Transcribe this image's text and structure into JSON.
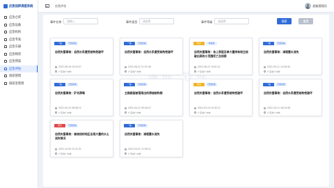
{
  "app": {
    "title": "应急指挥调度系统"
  },
  "sidebar": {
    "items": [
      {
        "label": "应急仓库",
        "active": false
      },
      {
        "label": "应急设备",
        "active": false
      },
      {
        "label": "应急机构",
        "active": false
      },
      {
        "label": "应急专家",
        "active": false
      },
      {
        "label": "应急车辆",
        "active": false
      },
      {
        "label": "应急物资",
        "active": false
      },
      {
        "label": "应急预案",
        "active": false
      },
      {
        "label": "应急评估",
        "active": true
      },
      {
        "label": "值班管理",
        "active": false
      },
      {
        "label": "值班室管理",
        "active": false
      }
    ]
  },
  "header": {
    "breadcrumb": "应急评估",
    "username": "超级管理员"
  },
  "filters": {
    "name_label": "事件名称",
    "name_placeholder": "请输入",
    "type_label": "事件类型",
    "type_placeholder": "请选择",
    "level_label": "事件等级",
    "level_placeholder": "请选择",
    "search_label": "搜索",
    "reset_label": "重置"
  },
  "colors": {
    "primary": "#2f6bd8",
    "level_blue": "#2f6bd8",
    "level_yellow": "#f0b429",
    "level_red": "#e04848"
  },
  "watermark": "博创 软件",
  "cards": [
    {
      "level": "一般",
      "level_color": "#2f6bd8",
      "status": "已经完成",
      "title": "自然灾害事故：自然水系遭受结构性破坏",
      "date": "2022-08-16 15:23:07",
      "location": "广东省广州市"
    },
    {
      "level": "一般",
      "level_color": "#2f6bd8",
      "status": "已经完成",
      "title": "自然灾害事故：自然水系遭受结构性破坏",
      "date": "2022-06-22 21:51:56",
      "location": "广东省广州市"
    },
    {
      "level": "较大",
      "level_color": "#f0b429",
      "status": "未完成",
      "title": "自然灾害事故：岛上表层及单大量持有较主桂破出高的小范围死亡及线索",
      "date": "2022-06-22 19:01:21",
      "location": "广东省广州市"
    },
    {
      "level": "一般",
      "level_color": "#2f6bd8",
      "status": "已经完成",
      "title": "自然灾害事故：湖堤蓄水流失",
      "date": "2022-05-21 13:26:40",
      "location": "广东省广州市"
    },
    {
      "level": "一般",
      "level_color": "#2f6bd8",
      "status": "已经完成",
      "title": "自然灾害事故：矿坑滑塌",
      "date": "2022-04-19 06:06:12",
      "location": "广东省广州市"
    },
    {
      "level": "一般",
      "level_color": "#2f6bd8",
      "status": "已经完成",
      "title": "主路路面被落雨出的滑坡结构倒",
      "date": "2022-04-12 09:44:12",
      "location": "广东省广州市"
    },
    {
      "level": "较大",
      "level_color": "#f0b429",
      "status": "已经完成",
      "title": "自然灾害事故：自然水系遭受结构性破坏",
      "date": "2022-03-14 10:32:11",
      "location": "广东省广州市"
    },
    {
      "level": "一般",
      "level_color": "#2f6bd8",
      "status": "已经完成",
      "title": "自然灾害事故：自然水系遭受结构性破坏",
      "date": "2022-03-11 18:24:46",
      "location": "广东省广州市"
    },
    {
      "level": "重大",
      "level_color": "#e04848",
      "status": "已经完成",
      "title": "自然灾害事故：被坡线的地区出现大量的水土流失情况",
      "date": "2022-10-09 11:21:31",
      "location": "广东省广州市"
    },
    {
      "level": "一般",
      "level_color": "#2f6bd8",
      "status": "已经完成",
      "title": "自然灾害事故：湖堤蓄水流失",
      "date": "2022-03-01 11:56:12",
      "location": "广东省广州市"
    }
  ]
}
